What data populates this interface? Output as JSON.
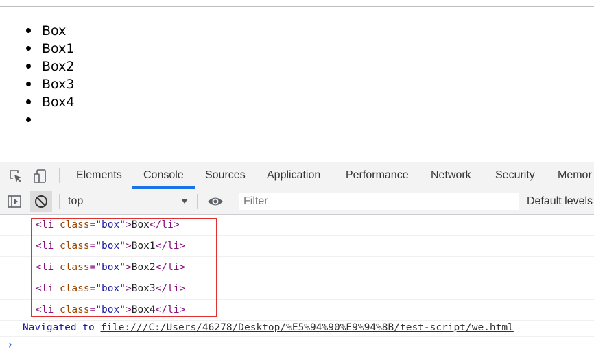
{
  "page": {
    "list_items": [
      "Box",
      "Box1",
      "Box2",
      "Box3",
      "Box4",
      ""
    ]
  },
  "devtools": {
    "tabs": [
      {
        "label": "Elements",
        "active": false
      },
      {
        "label": "Console",
        "active": true
      },
      {
        "label": "Sources",
        "active": false
      },
      {
        "label": "Application",
        "active": false
      },
      {
        "label": "Performance",
        "active": false
      },
      {
        "label": "Network",
        "active": false
      },
      {
        "label": "Security",
        "active": false
      },
      {
        "label": "Memor",
        "active": false
      }
    ],
    "toolbar": {
      "context": "top",
      "filter_placeholder": "Filter",
      "levels": "Default levels"
    },
    "icons": {
      "inspect": "inspect-element-icon",
      "device": "device-toggle-icon",
      "sidebar": "sidebar-toggle-icon",
      "clear": "clear-console-icon",
      "eye": "live-expression-icon"
    },
    "accent_color": "#1a73e8",
    "highlight_color": "#e03131"
  },
  "console": {
    "messages": [
      {
        "tag_open": "<li",
        "attr_name": "class",
        "attr_val": "\"box\"",
        "close_bracket": ">",
        "text": "Box",
        "tag_close": "</li>"
      },
      {
        "tag_open": "<li",
        "attr_name": "class",
        "attr_val": "\"box\"",
        "close_bracket": ">",
        "text": "Box1",
        "tag_close": "</li>"
      },
      {
        "tag_open": "<li",
        "attr_name": "class",
        "attr_val": "\"box\"",
        "close_bracket": ">",
        "text": "Box2",
        "tag_close": "</li>"
      },
      {
        "tag_open": "<li",
        "attr_name": "class",
        "attr_val": "\"box\"",
        "close_bracket": ">",
        "text": "Box3",
        "tag_close": "</li>"
      },
      {
        "tag_open": "<li",
        "attr_name": "class",
        "attr_val": "\"box\"",
        "close_bracket": ">",
        "text": "Box4",
        "tag_close": "</li>"
      }
    ],
    "navigated_prefix": "Navigated to",
    "navigated_url": "file:///C:/Users/46278/Desktop/%E5%94%90%E9%94%8B/test-script/we.html",
    "prompt": "›"
  }
}
